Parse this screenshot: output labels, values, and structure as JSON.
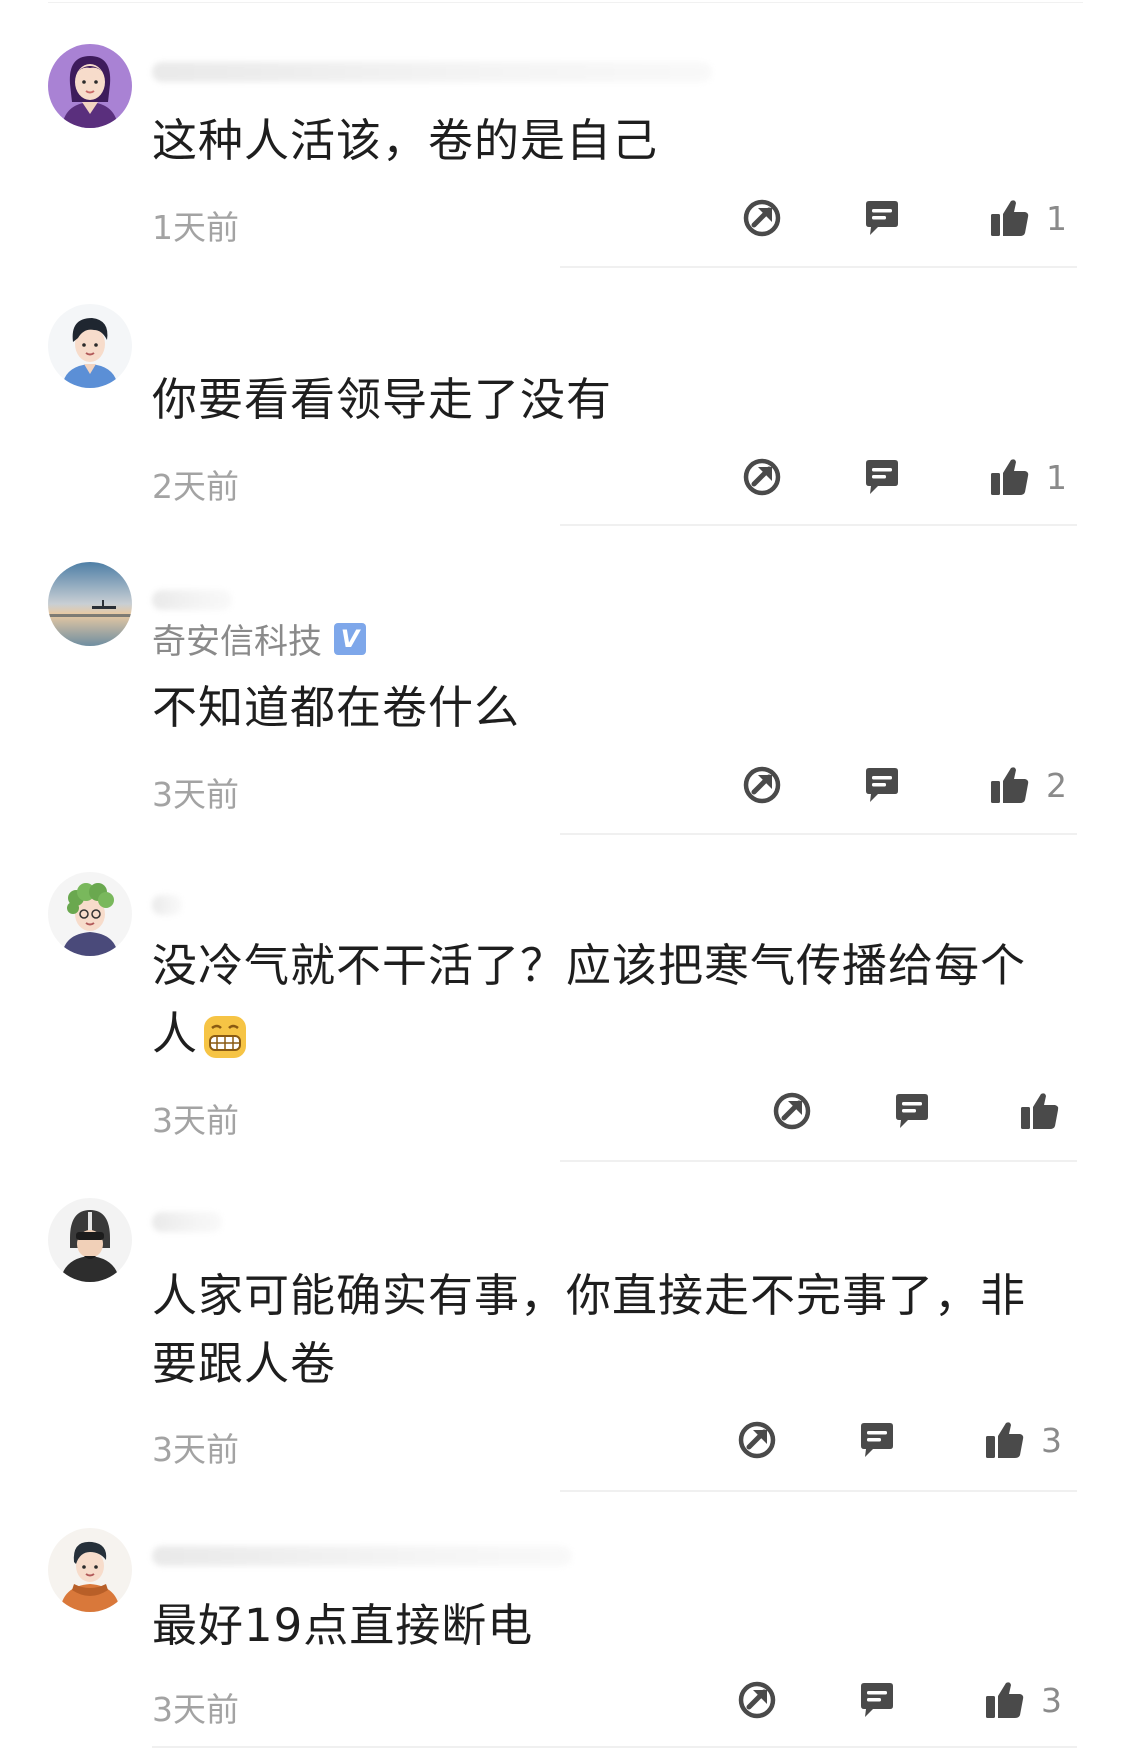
{
  "colors": {
    "text": "#1e1e1e",
    "meta": "#a3a3a3",
    "icon": "#4a4a4a",
    "verified": "#7ea7ea"
  },
  "icons": [
    "share-icon",
    "reply-icon",
    "like-icon"
  ],
  "comments": [
    {
      "text": "这种人活该，卷的是自己",
      "time": "1天前",
      "likes": "1"
    },
    {
      "text": "你要看看领导走了没有",
      "time": "2天前",
      "likes": "1"
    },
    {
      "verified_name": "奇安信科技",
      "text": "不知道都在卷什么",
      "time": "3天前",
      "likes": "2"
    },
    {
      "text": "没冷气就不干活了？应该把寒气传播给每个人",
      "time": "3天前",
      "likes": ""
    },
    {
      "text": "人家可能确实有事，你直接走不完事了，非要跟人卷",
      "time": "3天前",
      "likes": "3"
    },
    {
      "text": "最好19点直接断电",
      "time": "3天前",
      "likes": "3"
    }
  ]
}
